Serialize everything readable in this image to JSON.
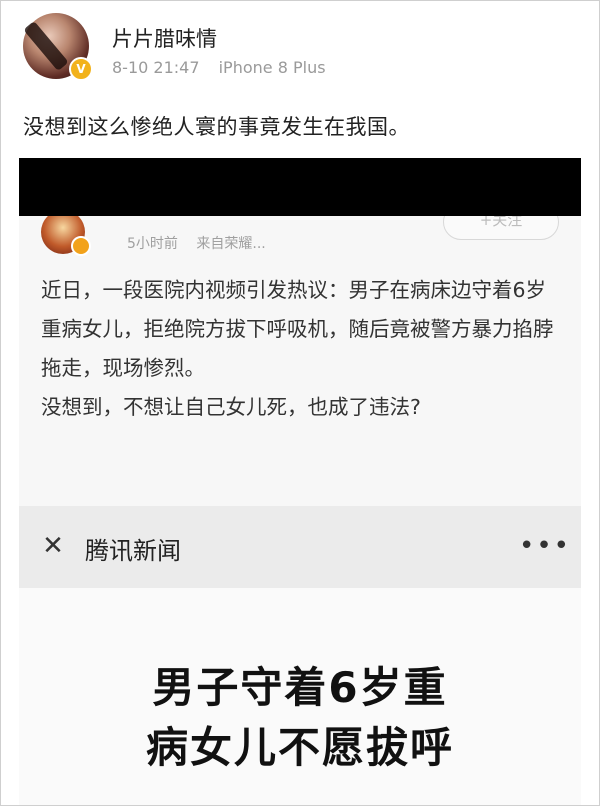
{
  "post": {
    "username": "片片腊味情",
    "timestamp": "8-10 21:47",
    "device": "iPhone 8 Plus",
    "text": "没想到这么惨绝人寰的事竟发生在我国。"
  },
  "embedded_post": {
    "time_ago": "5小时前",
    "source": "来自荣耀...",
    "follow_label": "+关注",
    "paragraph1": "近日，一段医院内视频引发热议：男子在病床边守着6岁重病女儿，拒绝院方拔下呼吸机，随后竟被警方暴力掐脖拖走，现场惨烈。",
    "paragraph2": "没想到，不想让自己女儿死，也成了违法?"
  },
  "news_bar": {
    "close_icon": "close-icon",
    "title": "腾讯新闻",
    "more_icon": "more-icon",
    "more_glyph": "•••"
  },
  "headline": {
    "line1": "男子守着6岁重",
    "line2": "病女儿不愿拔呼"
  }
}
